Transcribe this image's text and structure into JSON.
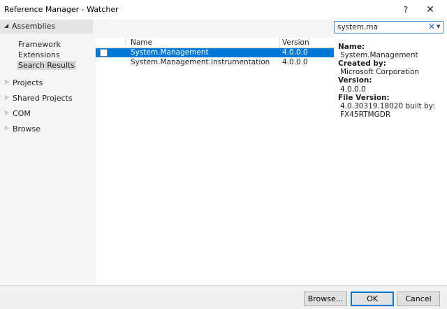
{
  "window": {
    "title": "Reference Manager - Watcher",
    "help_glyph": "?",
    "close_glyph": "✕"
  },
  "sidebar": {
    "assemblies": {
      "label": "Assemblies",
      "expanded_glyph": "◢"
    },
    "assemblies_children": [
      {
        "label": "Framework"
      },
      {
        "label": "Extensions"
      },
      {
        "label": "Search Results"
      }
    ],
    "collapsed_glyph": "▷",
    "items": [
      {
        "label": "Projects"
      },
      {
        "label": "Shared Projects"
      },
      {
        "label": "COM"
      },
      {
        "label": "Browse"
      }
    ]
  },
  "search": {
    "value": "system.ma",
    "clear_glyph": "✕",
    "dropdown_glyph": "▼"
  },
  "grid": {
    "columns": [
      "Name",
      "Version"
    ],
    "rows": [
      {
        "name": "System.Management",
        "version": "4.0.0.0"
      },
      {
        "name": "System.Management.Instrumentation",
        "version": "4.0.0.0"
      }
    ]
  },
  "details": {
    "name_label": "Name:",
    "name_value": "System.Management",
    "created_label": "Created by:",
    "created_value": "Microsoft Corporation",
    "version_label": "Version:",
    "version_value": "4.0.0.0",
    "file_version_label": "File Version:",
    "file_version_value_1": "4.0.30319.18020 built by:",
    "file_version_value_2": "FX45RTMGDR"
  },
  "buttons": {
    "browse": "Browse...",
    "ok": "OK",
    "cancel": "Cancel"
  },
  "colors": {
    "selection": "#0078d7",
    "accent": "#0078d7"
  }
}
